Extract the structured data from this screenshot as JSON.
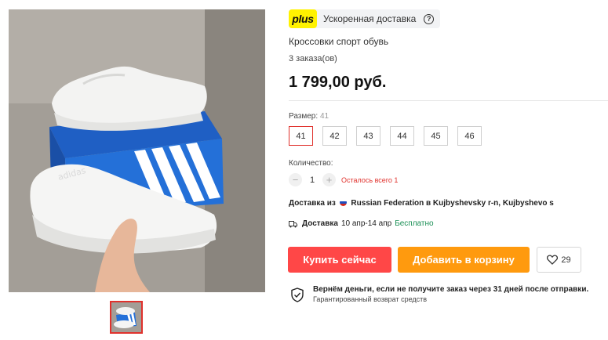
{
  "plus": {
    "logo_text": "plus",
    "label": "Ускоренная доставка",
    "help_icon": "question-circle-icon"
  },
  "product": {
    "title": "Кроссовки спорт обувь",
    "orders": "3 заказа(ов)",
    "price": "1 799,00 руб."
  },
  "size": {
    "label": "Размер:",
    "selected": "41",
    "options": [
      "41",
      "42",
      "43",
      "44",
      "45",
      "46"
    ]
  },
  "quantity": {
    "label": "Количество:",
    "minus": "−",
    "value": "1",
    "plus": "+",
    "stock_note": "Осталось всего 1"
  },
  "delivery": {
    "from_prefix": "Доставка из",
    "from_location": "Russian Federation в Kujbyshevsky r-n, Kujbyshevo s",
    "flag_icon": "russia-flag-icon",
    "shipping_label": "Доставка",
    "shipping_dates": "10 апр-14 апр",
    "shipping_price": "Бесплатно",
    "truck_icon": "truck-icon"
  },
  "actions": {
    "buy_now": "Купить сейчас",
    "add_to_cart": "Добавить в корзину",
    "wishlist_count": "29",
    "heart_icon": "heart-icon"
  },
  "guarantee": {
    "main": "Вернём деньги, если не получите заказ через 31 дней после отправки.",
    "sub": "Гарантированный возврат средств",
    "shield_icon": "shield-check-icon"
  },
  "colors": {
    "accent_red": "#ff4747",
    "accent_orange": "#ff9a0e",
    "plus_yellow": "#fff200",
    "stock_red": "#e0312c",
    "free_green": "#1a8f55"
  }
}
